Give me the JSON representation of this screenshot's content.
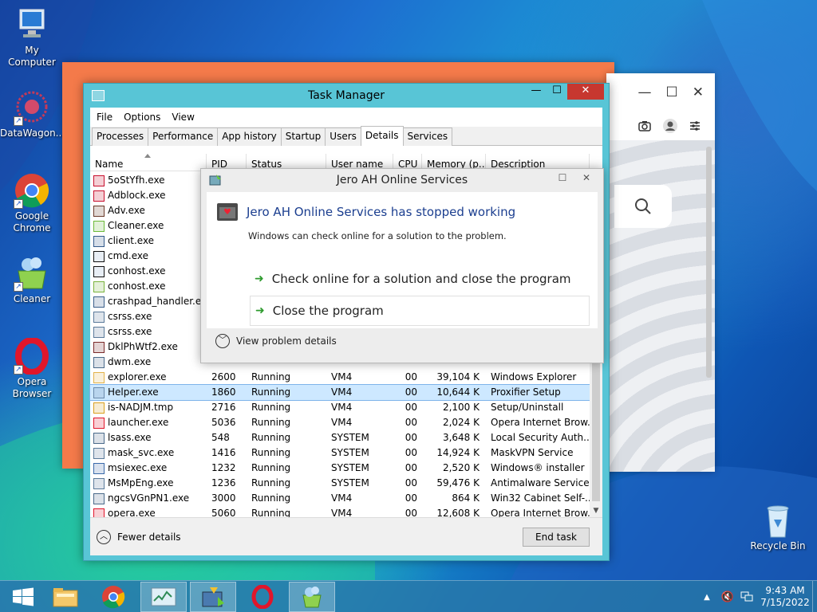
{
  "desktop": {
    "icons": [
      {
        "label": "My Computer",
        "icon": "computer-icon"
      },
      {
        "label": "DataWagon...",
        "icon": "datawagon-icon"
      },
      {
        "label": "Google Chrome",
        "icon": "chrome-icon"
      },
      {
        "label": "Cleaner",
        "icon": "cleaner-icon"
      },
      {
        "label": "Opera Browser",
        "icon": "opera-icon"
      },
      {
        "label": "Recycle Bin",
        "icon": "recycle-bin-icon"
      }
    ]
  },
  "task_manager": {
    "title": "Task Manager",
    "menu": [
      "File",
      "Options",
      "View"
    ],
    "tabs": [
      "Processes",
      "Performance",
      "App history",
      "Startup",
      "Users",
      "Details",
      "Services"
    ],
    "active_tab": "Details",
    "columns": [
      "Name",
      "PID",
      "Status",
      "User name",
      "CPU",
      "Memory (p...",
      "Description"
    ],
    "rows": [
      {
        "name": "5oStYfh.exe",
        "pid": "",
        "status": "",
        "user": "",
        "cpu": "",
        "mem": "",
        "desc": ""
      },
      {
        "name": "Adblock.exe",
        "pid": "",
        "status": "",
        "user": "",
        "cpu": "",
        "mem": "",
        "desc": ""
      },
      {
        "name": "Adv.exe",
        "pid": "",
        "status": "",
        "user": "",
        "cpu": "",
        "mem": "",
        "desc": ""
      },
      {
        "name": "Cleaner.exe",
        "pid": "",
        "status": "",
        "user": "",
        "cpu": "",
        "mem": "",
        "desc": ""
      },
      {
        "name": "client.exe",
        "pid": "",
        "status": "",
        "user": "",
        "cpu": "",
        "mem": "",
        "desc": ""
      },
      {
        "name": "cmd.exe",
        "pid": "",
        "status": "",
        "user": "",
        "cpu": "",
        "mem": "",
        "desc": ""
      },
      {
        "name": "conhost.exe",
        "pid": "",
        "status": "",
        "user": "",
        "cpu": "",
        "mem": "",
        "desc": ""
      },
      {
        "name": "conhost.exe",
        "pid": "",
        "status": "",
        "user": "",
        "cpu": "",
        "mem": "",
        "desc": ""
      },
      {
        "name": "crashpad_handler.exe",
        "pid": "",
        "status": "",
        "user": "",
        "cpu": "",
        "mem": "",
        "desc": ""
      },
      {
        "name": "csrss.exe",
        "pid": "",
        "status": "",
        "user": "",
        "cpu": "",
        "mem": "",
        "desc": ""
      },
      {
        "name": "csrss.exe",
        "pid": "",
        "status": "",
        "user": "",
        "cpu": "",
        "mem": "",
        "desc": ""
      },
      {
        "name": "DklPhWtf2.exe",
        "pid": "",
        "status": "",
        "user": "",
        "cpu": "",
        "mem": "",
        "desc": ""
      },
      {
        "name": "dwm.exe",
        "pid": "",
        "status": "",
        "user": "",
        "cpu": "",
        "mem": "",
        "desc": ""
      },
      {
        "name": "explorer.exe",
        "pid": "2600",
        "status": "Running",
        "user": "VM4",
        "cpu": "00",
        "mem": "39,104 K",
        "desc": "Windows Explorer"
      },
      {
        "name": "Helper.exe",
        "pid": "1860",
        "status": "Running",
        "user": "VM4",
        "cpu": "00",
        "mem": "10,644 K",
        "desc": "Proxifier Setup"
      },
      {
        "name": "is-NADJM.tmp",
        "pid": "2716",
        "status": "Running",
        "user": "VM4",
        "cpu": "00",
        "mem": "2,100 K",
        "desc": "Setup/Uninstall"
      },
      {
        "name": "launcher.exe",
        "pid": "5036",
        "status": "Running",
        "user": "VM4",
        "cpu": "00",
        "mem": "2,024 K",
        "desc": "Opera Internet Brow..."
      },
      {
        "name": "lsass.exe",
        "pid": "548",
        "status": "Running",
        "user": "SYSTEM",
        "cpu": "00",
        "mem": "3,648 K",
        "desc": "Local Security Auth..."
      },
      {
        "name": "mask_svc.exe",
        "pid": "1416",
        "status": "Running",
        "user": "SYSTEM",
        "cpu": "00",
        "mem": "14,924 K",
        "desc": "MaskVPN Service"
      },
      {
        "name": "msiexec.exe",
        "pid": "1232",
        "status": "Running",
        "user": "SYSTEM",
        "cpu": "00",
        "mem": "2,520 K",
        "desc": "Windows® installer"
      },
      {
        "name": "MsMpEng.exe",
        "pid": "1236",
        "status": "Running",
        "user": "SYSTEM",
        "cpu": "00",
        "mem": "59,476 K",
        "desc": "Antimalware Service..."
      },
      {
        "name": "ngcsVGnPN1.exe",
        "pid": "3000",
        "status": "Running",
        "user": "VM4",
        "cpu": "00",
        "mem": "864 K",
        "desc": "Win32 Cabinet Self-..."
      },
      {
        "name": "opera.exe",
        "pid": "5060",
        "status": "Running",
        "user": "VM4",
        "cpu": "00",
        "mem": "12,608 K",
        "desc": "Opera Internet Brow..."
      }
    ],
    "selected_row": "Helper.exe",
    "fewer_details": "Fewer details",
    "end_task": "End task"
  },
  "error_dialog": {
    "title": "Jero AH Online Services",
    "heading": "Jero AH Online Services has stopped working",
    "subtext": "Windows can check online for a solution to the problem.",
    "option1": "Check online for a solution and close the program",
    "option2": "Close the program",
    "view_details": "View problem details"
  },
  "taskbar": {
    "time": "9:43 AM",
    "date": "7/15/2022"
  },
  "colors": {
    "taskmgr_frame": "#58c5d6",
    "close_red": "#c7372f",
    "dialog_heading": "#1b3e8f",
    "orange_window": "#f47a4a"
  }
}
